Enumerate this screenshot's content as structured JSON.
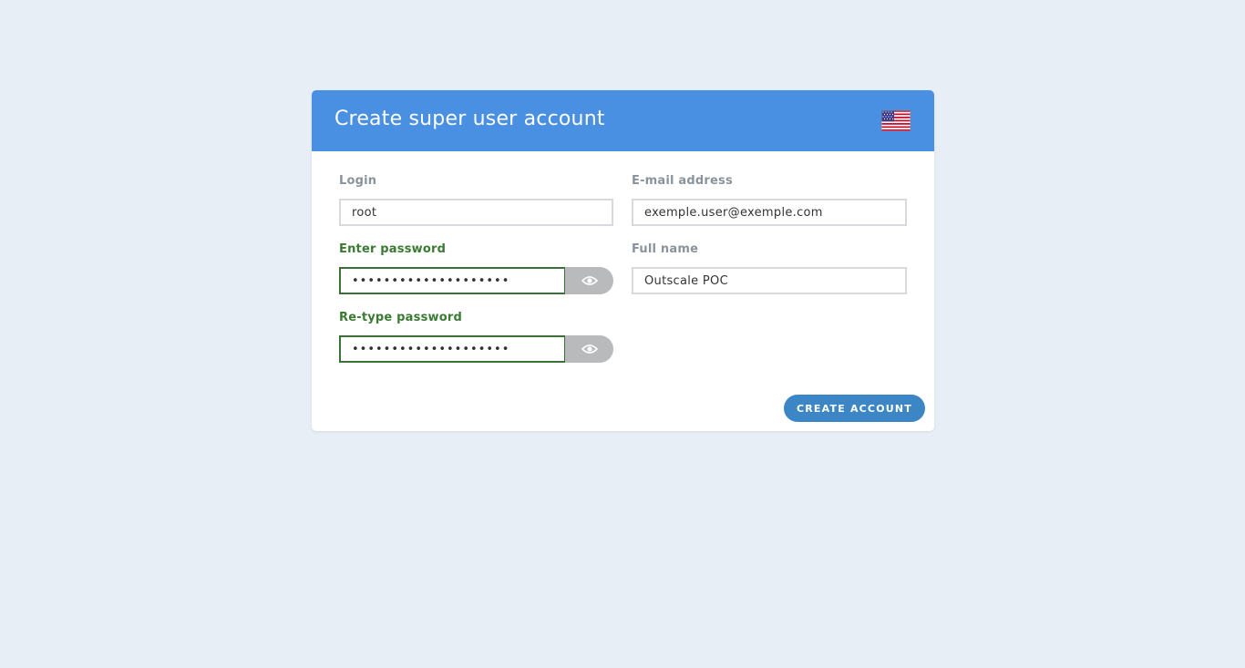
{
  "header": {
    "title": "Create super user account",
    "language_icon": "us-flag-icon"
  },
  "form": {
    "login": {
      "label": "Login",
      "value": "root"
    },
    "email": {
      "label": "E-mail address",
      "value": "exemple.user@exemple.com"
    },
    "password": {
      "label": "Enter password",
      "value": "••••••••••••••••••••",
      "toggle_icon": "eye-icon"
    },
    "full_name": {
      "label": "Full name",
      "value": "Outscale POC"
    },
    "retype_password": {
      "label": "Re-type password",
      "value": "••••••••••••••••••••",
      "toggle_icon": "eye-icon"
    },
    "submit_label": "CREATE ACCOUNT"
  },
  "colors": {
    "page_background": "#e8eef6",
    "header_background": "#4a90e2",
    "button_background": "#3d86c6",
    "valid_green": "#3a7a32",
    "label_gray": "#8a939b"
  }
}
